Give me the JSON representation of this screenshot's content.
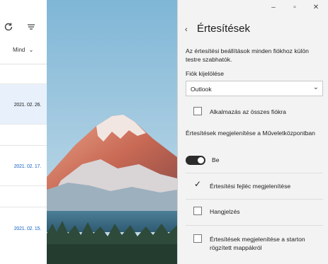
{
  "mail_list": {
    "filter_label": "Mind",
    "dates": [
      "2021. 02. 26.",
      "2021. 02. 17.",
      "2021. 02. 15."
    ]
  },
  "window": {
    "minimize": "–",
    "maximize": "▫",
    "close": "✕"
  },
  "settings": {
    "back_glyph": "‹",
    "title": "Értesítések",
    "description": "Az értesítési beállítások minden fiókhoz külön testre szabhatók.",
    "account_select_label": "Fiók kijelölése",
    "account_selected": "Outlook",
    "apply_all_label": "Alkalmazás az összes fiókra",
    "action_center_label": "Értesítések megjelenítése a Műveletközpontban",
    "action_center_toggle": "Be",
    "banner_label": "Értesítési fejléc megjelenítése",
    "sound_label": "Hangjelzés",
    "pinned_folders_label": "Értesítések megjelenítése a starton rögzített mappákról",
    "checks": {
      "apply_all": false,
      "banner": true,
      "sound": false,
      "pinned_folders": false
    }
  },
  "colors": {
    "accent": "#1a62c4",
    "selected_row": "#e8f1fb",
    "pane_bg": "#f3f3f3",
    "toggle_on": "#2b2b2b"
  },
  "icons": [
    "sync-icon",
    "filter-icon",
    "chevron-down-icon",
    "back-arrow-icon",
    "checkmark-icon"
  ]
}
